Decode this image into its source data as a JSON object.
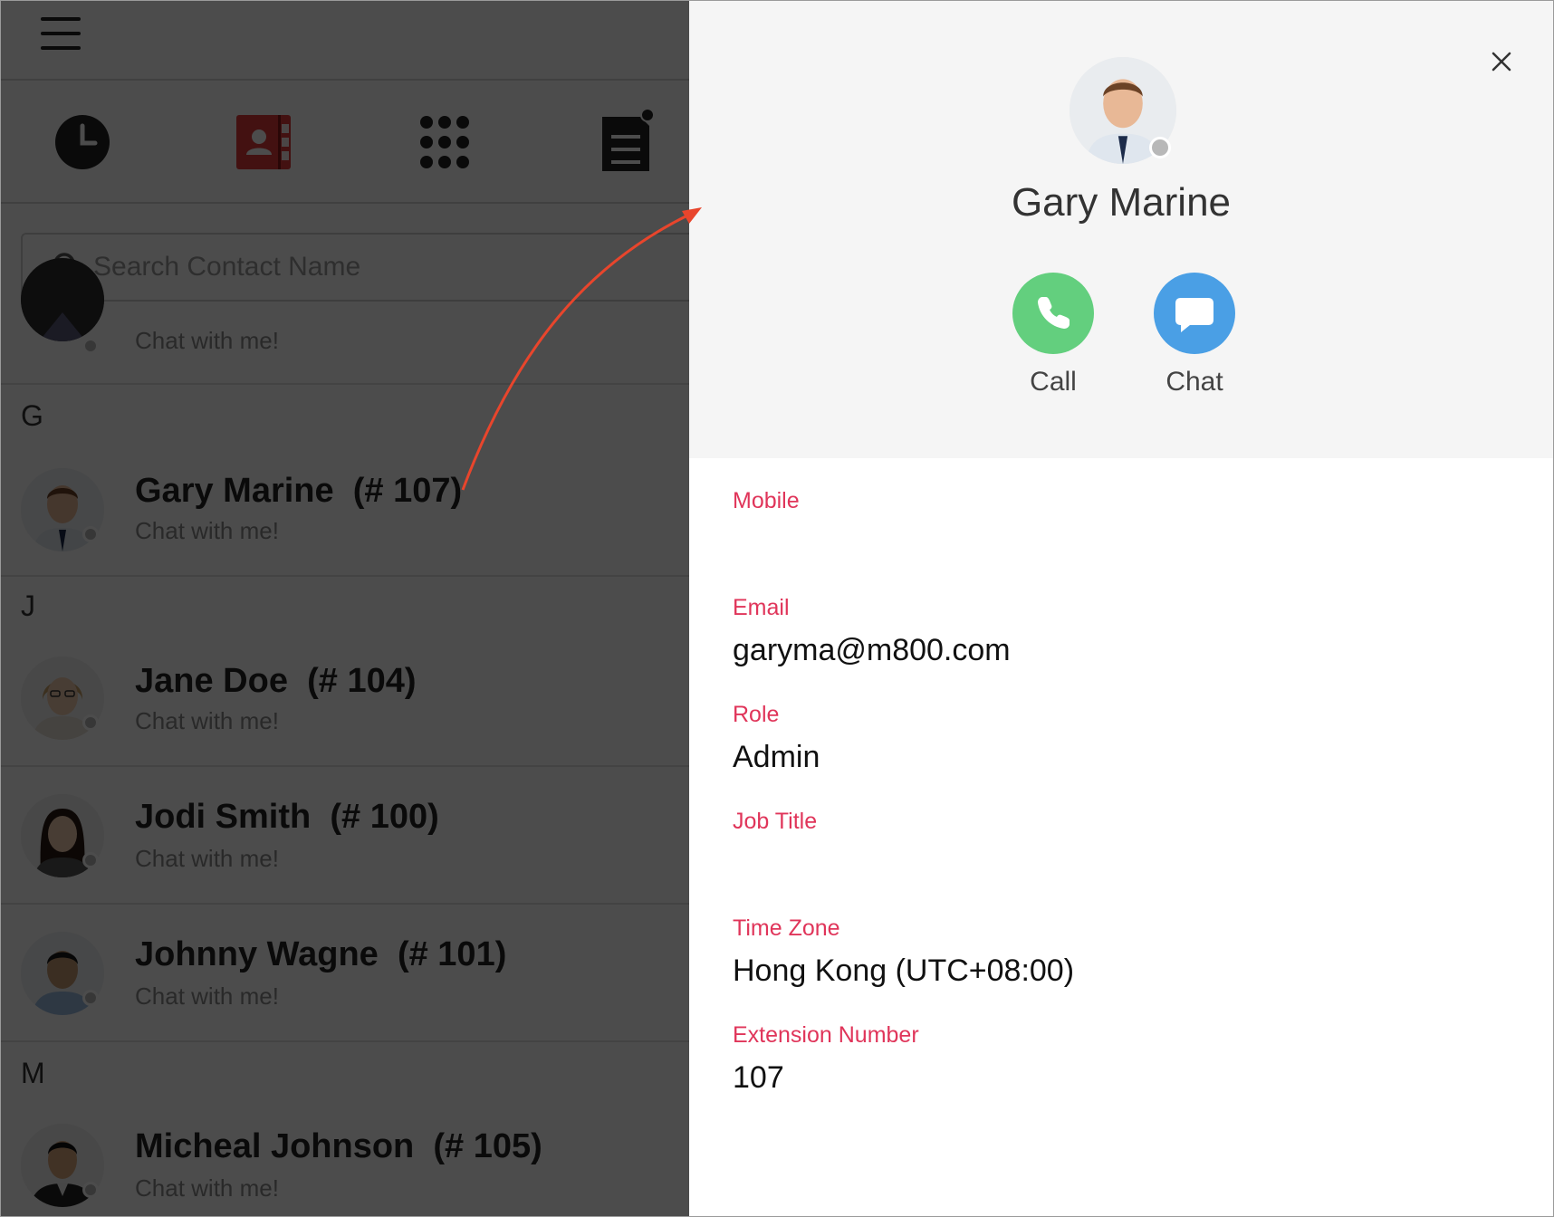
{
  "left": {
    "search": {
      "placeholder": "Search Contact Name"
    },
    "partial_row": {
      "status": "Chat with me!"
    },
    "sections": [
      {
        "letter": "G"
      },
      {
        "letter": "J"
      },
      {
        "letter": "M"
      }
    ],
    "contacts": [
      {
        "name": "Gary Marine",
        "ext": "(# 107)",
        "status": "Chat with me!"
      },
      {
        "name": "Jane Doe",
        "ext": "(# 104)",
        "status": "Chat with me!"
      },
      {
        "name": "Jodi Smith",
        "ext": "(# 100)",
        "status": "Chat with me!"
      },
      {
        "name": "Johnny Wagne",
        "ext": "(# 101)",
        "status": "Chat with me!"
      },
      {
        "name": "Micheal Johnson",
        "ext": "(# 105)",
        "status": "Chat with me!"
      }
    ]
  },
  "detail": {
    "name": "Gary Marine",
    "actions": {
      "call": "Call",
      "chat": "Chat"
    },
    "fields": [
      {
        "label": "Mobile",
        "value": ""
      },
      {
        "label": "Email",
        "value": "garyma@m800.com"
      },
      {
        "label": "Role",
        "value": "Admin"
      },
      {
        "label": "Job Title",
        "value": ""
      },
      {
        "label": "Time Zone",
        "value": "Hong Kong (UTC+08:00)"
      },
      {
        "label": "Extension Number",
        "value": "107"
      }
    ]
  },
  "colors": {
    "accent_red": "#e0355a",
    "call_green": "#63cf7e",
    "chat_blue": "#4a9fe5",
    "contacts_tab_red": "#e23b3b",
    "annotation_arrow": "#e8452c"
  },
  "icons": [
    "hamburger-icon",
    "clock-icon",
    "contacts-book-icon",
    "keypad-icon",
    "notes-icon",
    "search-icon",
    "close-icon",
    "phone-icon",
    "chat-bubble-icon"
  ]
}
